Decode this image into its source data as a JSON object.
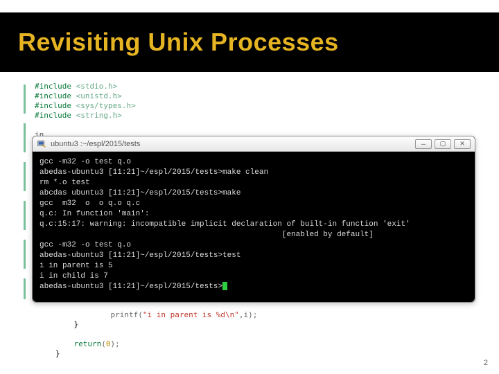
{
  "title": "Revisiting Unix Processes",
  "code_top": {
    "l1a": "#include ",
    "l1b": "<stdio.h>",
    "l2a": "#include ",
    "l2b": "<unistd.h>",
    "l3a": "#include ",
    "l3b": "<sys/types.h>",
    "l4a": "#include ",
    "l4b": "<string.h>",
    "l5": "in",
    "l6": "{"
  },
  "win": {
    "title": "ubuntu3 :~/espl/2015/tests"
  },
  "term": {
    "l1": "gcc -m32 -o test q.o",
    "l2": "abedas-ubuntu3 [11:21]~/espl/2015/tests>make clean",
    "l3": "rm *.o test",
    "l4": "abcdas ubuntu3 [11:21]~/espl/2015/tests>make",
    "l5": "gcc  m32  o  o q.o q.c",
    "l6": "q.c: In function 'main':",
    "l7": "q.c:15:17: warning: incompatible implicit declaration of built-in function 'exit'",
    "l8": "                                                     [enabled by default]",
    "l9": "gcc -m32 -o test q.o",
    "l10": "abedas-ubuntu3 [11:21]~/espl/2015/tests>test",
    "l11": "i in parent is 5",
    "l12": "i in child is 7",
    "l13": "abedas-ubuntu3 [11:21]~/espl/2015/tests>"
  },
  "code_bottom": {
    "printf_fn": "printf(",
    "printf_str": "\"i in parent is %d\\n\"",
    "printf_end": ",i);",
    "brace1": "}",
    "ret_kw": "return",
    "ret_rest": "(0);",
    "brace2": "}"
  },
  "page": "2"
}
